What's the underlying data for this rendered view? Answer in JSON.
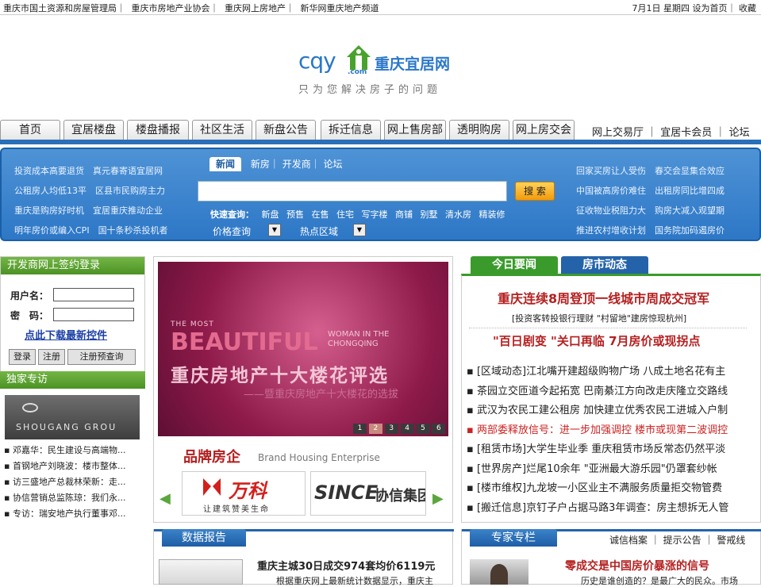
{
  "topbar": {
    "links": [
      "重庆市国土资源和房屋管理局",
      "重庆市房地产业协会",
      "重庆网上房地产",
      "新华网重庆地产频道"
    ],
    "date": "7月1日",
    "weekday": "星期四",
    "set_home": "设为首页",
    "favorite": "收藏"
  },
  "logo": {
    "latin": "cqy",
    "dotcom": ".com",
    "cn": "重庆宜居网",
    "slogan": "只为您解决房子的问题"
  },
  "nav": {
    "tabs": [
      "首页",
      "宜居楼盘",
      "楼盘播报",
      "社区生活",
      "新盘公告",
      "拆迁信息",
      "网上售房部",
      "透明购房",
      "网上房交会"
    ],
    "right": [
      "网上交易厅",
      "宜居卡会员",
      "论坛"
    ]
  },
  "search": {
    "left_links": [
      [
        "投资成本高要退货",
        "真元春寄语宜居网"
      ],
      [
        "公租房人均低13平",
        "区县市民购房主力"
      ],
      [
        "重庆是购房好时机",
        "宜居重庆推动企业"
      ],
      [
        "明年房价或编入CPI",
        "国十条秒杀投机者"
      ]
    ],
    "tabs": [
      "新闻",
      "新房",
      "开发商",
      "论坛"
    ],
    "button": "搜 索",
    "quick_label": "快速查询：",
    "quick": [
      "新盘",
      "预售",
      "在售",
      "住宅",
      "写字楼",
      "商铺",
      "别墅",
      "清水房",
      "精装修"
    ],
    "price_label": "价格查询",
    "area_label": "热点区域",
    "right_links": [
      [
        "回家买房让人受伤",
        "春交会显集合效应"
      ],
      [
        "中国被高房价难住",
        "出租房同比增四成"
      ],
      [
        "征收物业税阻力大",
        "购房大减入观望期"
      ],
      [
        "推进农村增收计划",
        "国务院加码遏房价"
      ]
    ]
  },
  "login": {
    "title": "开发商网上签约登录",
    "user_label": "用户名：",
    "pass_label": "密　码：",
    "download": "点此下载最新控件",
    "buttons": [
      "登录",
      "注册",
      "注册预查询"
    ]
  },
  "exclusive": {
    "title": "独家专访",
    "image_caption": "SHOUGANG GROU",
    "items": [
      "邓嘉华：民生建设与高端物...",
      "首钢地产刘晓波：楼市整体...",
      "访三盛地产总裁林荣新：走...",
      "协信营销总监陈琼：我们永...",
      "专访：瑞安地产执行董事邓..."
    ]
  },
  "banner": {
    "the_most": "THE MOST",
    "big": "BEAUTIFUL",
    "woman": "WOMAN IN THE CHONGQING",
    "cn": "重庆房地产十大楼花评选",
    "sub": "——暨重庆房地产十大楼花的选拔",
    "pages": [
      "1",
      "2",
      "3",
      "4",
      "5",
      "6"
    ],
    "active_page": 2
  },
  "brand": {
    "title": "品牌房企",
    "en": "Brand Housing Enterprise",
    "vanke": "万科",
    "vanke_slogan": "让建筑赞美生命",
    "since": "SINCE",
    "since_cn": "协信集团"
  },
  "news": {
    "tabs": [
      "今日要闻",
      "房市动态"
    ],
    "headline": "重庆连续8周登顶一线城市周成交冠军",
    "sub": "[投资客转投银行理财  \"村留地\"建房惊现杭州]",
    "headline2": "\"百日剧变 \"关口再临  7月房价或现拐点",
    "items": [
      "[区域动态]江北嘴开建超级购物广场  八成土地名花有主",
      "茶园立交匝道今起拓宽  巴南綦江方向改走庆隆立交路线",
      "武汉为农民工建公租房  加快建立优秀农民工进城入户制",
      "两部委释放信号：进一步加强调控  楼市或现第二波调控",
      "[租赁市场]大学生毕业季  重庆租赁市场反常态仍然平淡",
      "[世界房产]烂尾10余年  \"亚洲最大游乐园\"仍罩套纱帐",
      "[楼市维权]九龙坡一小区业主不满服务质量拒交物管费",
      "[搬迁信息]京钉子户占据马路3年调查：房主想拆无人管"
    ]
  },
  "data_report": {
    "title": "数据报告",
    "headline": "重庆主城30日成交974套均价6119元",
    "snippet": "根据重庆网上最新统计数据显示，重庆主"
  },
  "expert": {
    "title": "专家专栏",
    "links": [
      "诚信档案",
      "提示公告",
      "警戒线"
    ],
    "headline": "零成交是中国房价暴涨的信号",
    "snippet": "历史是谁创造的？是最广大的民众。市场"
  },
  "colors": {
    "brand_blue": "#2463a9",
    "green": "#3a9b2c",
    "red_title": "#b52020"
  }
}
